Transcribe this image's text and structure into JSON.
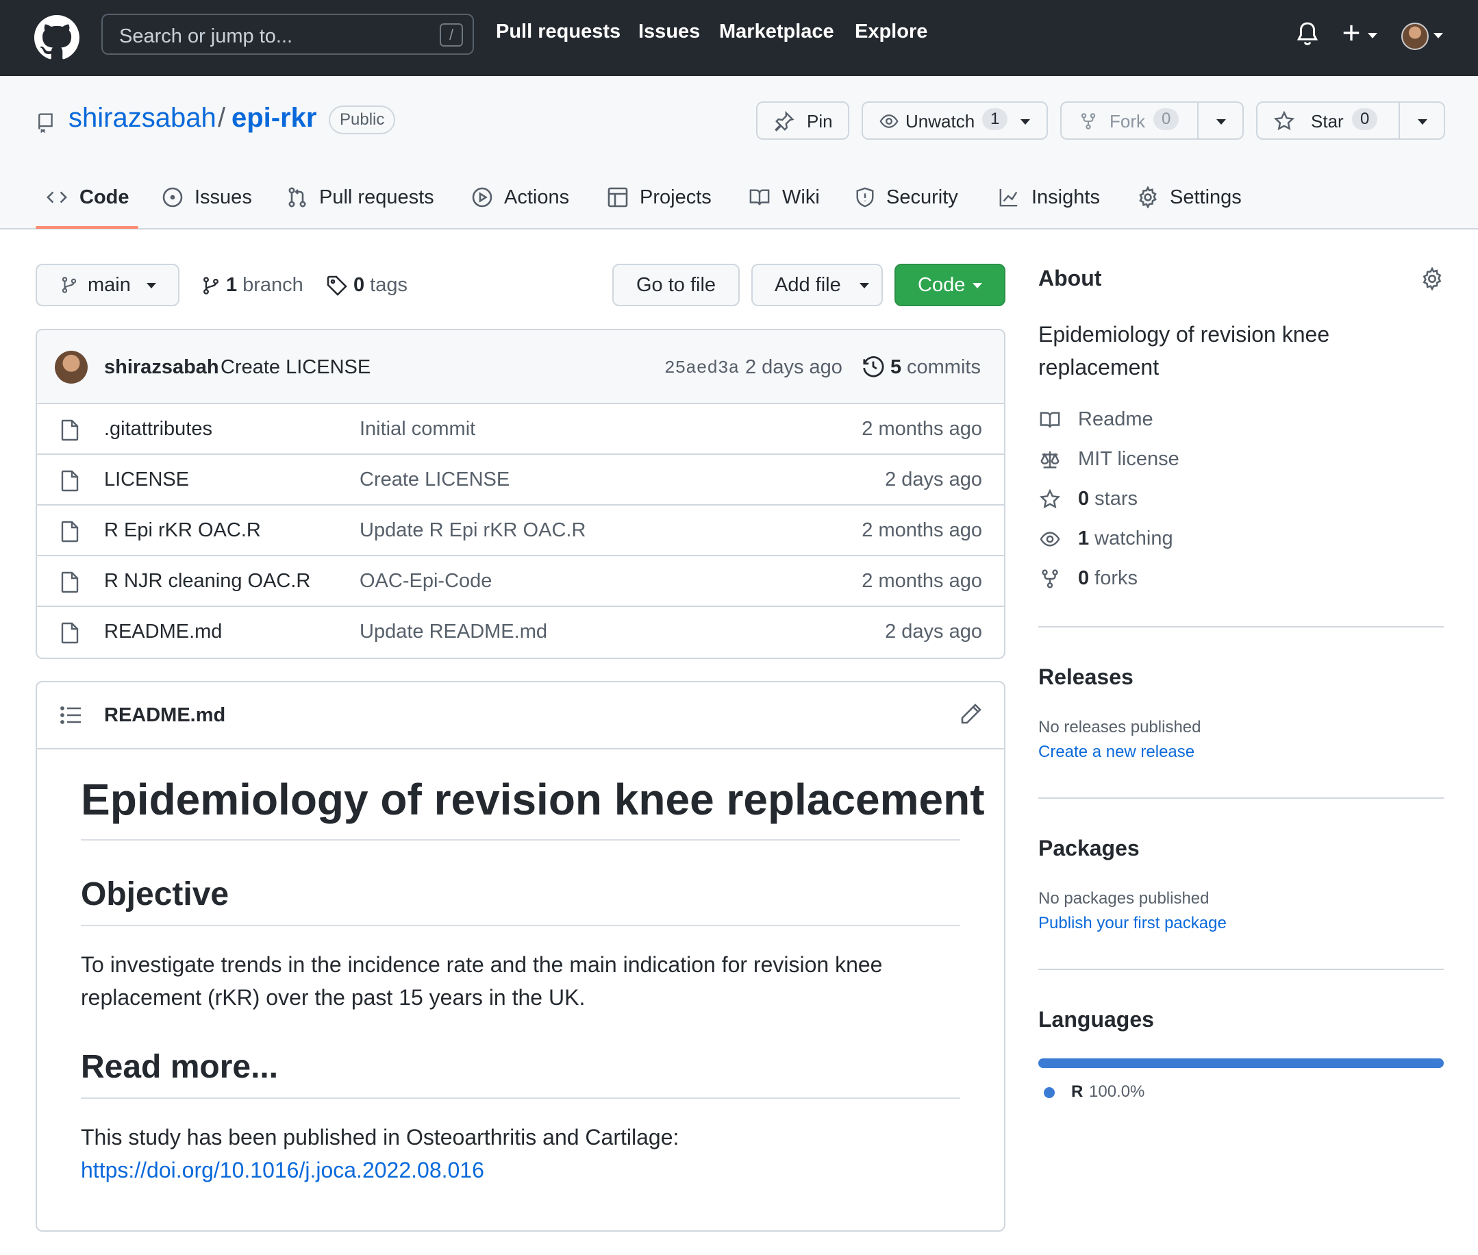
{
  "header": {
    "search_placeholder": "Search or jump to...",
    "search_shortcut": "/",
    "nav": [
      "Pull requests",
      "Issues",
      "Marketplace",
      "Explore"
    ]
  },
  "repo": {
    "owner": "shirazsabah",
    "separator": "/",
    "name": "epi-rkr",
    "visibility": "Public",
    "pin_label": "Pin",
    "unwatch_label": "Unwatch",
    "watch_count": "1",
    "fork_label": "Fork",
    "fork_count": "0",
    "star_label": "Star",
    "star_count": "0"
  },
  "tabs": [
    "Code",
    "Issues",
    "Pull requests",
    "Actions",
    "Projects",
    "Wiki",
    "Security",
    "Insights",
    "Settings"
  ],
  "filenav": {
    "branch": "main",
    "branch_count": "1",
    "branch_word": "branch",
    "tag_count": "0",
    "tag_word": "tags",
    "goto_label": "Go to file",
    "addfile_label": "Add file",
    "code_label": "Code"
  },
  "commit": {
    "author": "shirazsabah",
    "message": "Create LICENSE",
    "sha": "25aed3a",
    "age": "2 days ago",
    "commit_count": "5",
    "commit_word": "commits"
  },
  "files": [
    {
      "name": ".gitattributes",
      "message": "Initial commit",
      "age": "2 months ago"
    },
    {
      "name": "LICENSE",
      "message": "Create LICENSE",
      "age": "2 days ago"
    },
    {
      "name": "R Epi rKR OAC.R",
      "message": "Update R Epi rKR OAC.R",
      "age": "2 months ago"
    },
    {
      "name": "R NJR cleaning OAC.R",
      "message": "OAC-Epi-Code",
      "age": "2 months ago"
    },
    {
      "name": "README.md",
      "message": "Update README.md",
      "age": "2 days ago"
    }
  ],
  "readme": {
    "filename": "README.md",
    "title": "Epidemiology of revision knee replacement",
    "objective_heading": "Objective",
    "objective_text": "To investigate trends in the incidence rate and the main indication for revision knee replacement (rKR) over the past 15 years in the UK.",
    "readmore_heading": "Read more...",
    "readmore_text": "This study has been published in Osteoarthritis and Cartilage:",
    "doi_link": "https://doi.org/10.1016/j.joca.2022.08.016"
  },
  "about": {
    "heading": "About",
    "description": "Epidemiology of revision knee replacement",
    "readme": "Readme",
    "license": "MIT license",
    "stars_count": "0",
    "stars_word": "stars",
    "watching_count": "1",
    "watching_word": "watching",
    "forks_count": "0",
    "forks_word": "forks"
  },
  "releases": {
    "heading": "Releases",
    "status": "No releases published",
    "link": "Create a new release"
  },
  "packages": {
    "heading": "Packages",
    "status": "No packages published",
    "link": "Publish your first package"
  },
  "languages": {
    "heading": "Languages",
    "items": [
      {
        "name": "R",
        "percent": "100.0%",
        "fraction": 1.0,
        "color": "#3b7bd4"
      }
    ]
  },
  "colors": {
    "accent": "#0969da",
    "primary_button": "#2da44e",
    "header_bg": "#24292f",
    "tab_underline": "#fd8c73"
  }
}
